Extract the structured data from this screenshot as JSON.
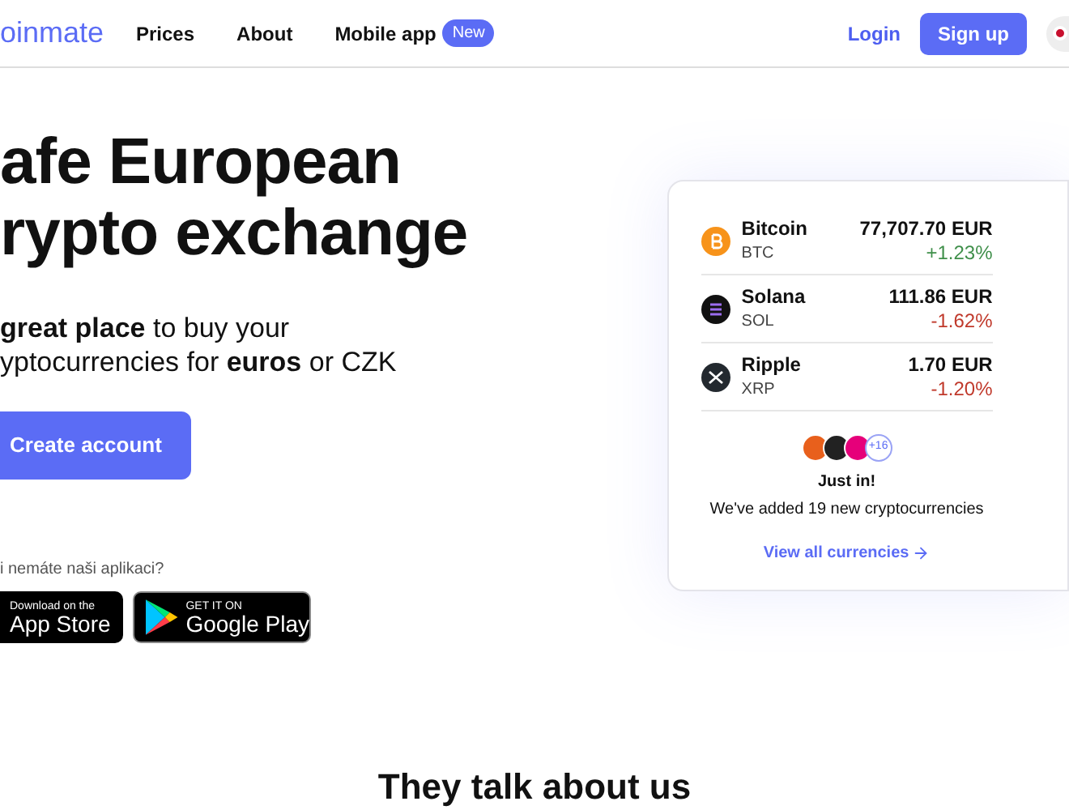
{
  "logo": "oinmate",
  "nav": [
    {
      "label": "Prices"
    },
    {
      "label": "About"
    },
    {
      "label": "Mobile app",
      "badge": "New"
    }
  ],
  "login": "Login",
  "signup": "Sign up",
  "hero": {
    "title_lines": [
      "afe European",
      "rypto exchange"
    ],
    "subtitle_lines": [
      "**great place** to buy your",
      "yptocurrencies for **euros** or CZK"
    ],
    "cta": "Create account",
    "app_prompt": "i nemáte naši aplikaci?",
    "stores": [
      {
        "kind": "apple",
        "top": "Download on the",
        "name": "App Store"
      },
      {
        "kind": "google",
        "top": "GET IT ON",
        "name": "Google Play"
      }
    ]
  },
  "market": {
    "coins": [
      {
        "kind": "bitcoin",
        "name": "Bitcoin",
        "symbol": "BTC",
        "price": "77,707.70 EUR",
        "change": "+1.23%",
        "color": "#3f8f4a"
      },
      {
        "kind": "solana",
        "name": "Solana",
        "symbol": "SOL",
        "price": "111.86 EUR",
        "change": "-1.62%",
        "color": "#c0392b"
      },
      {
        "kind": "ripple",
        "name": "Ripple",
        "symbol": "XRP",
        "price": "1.70 EUR",
        "change": "-1.20%",
        "color": "#c0392b"
      }
    ],
    "new_more": "+16",
    "just_in": "Just in!",
    "added_text": "We've added 19 new cryptocurrencies",
    "view_all": "View all currencies"
  },
  "section_title": "They talk about us"
}
